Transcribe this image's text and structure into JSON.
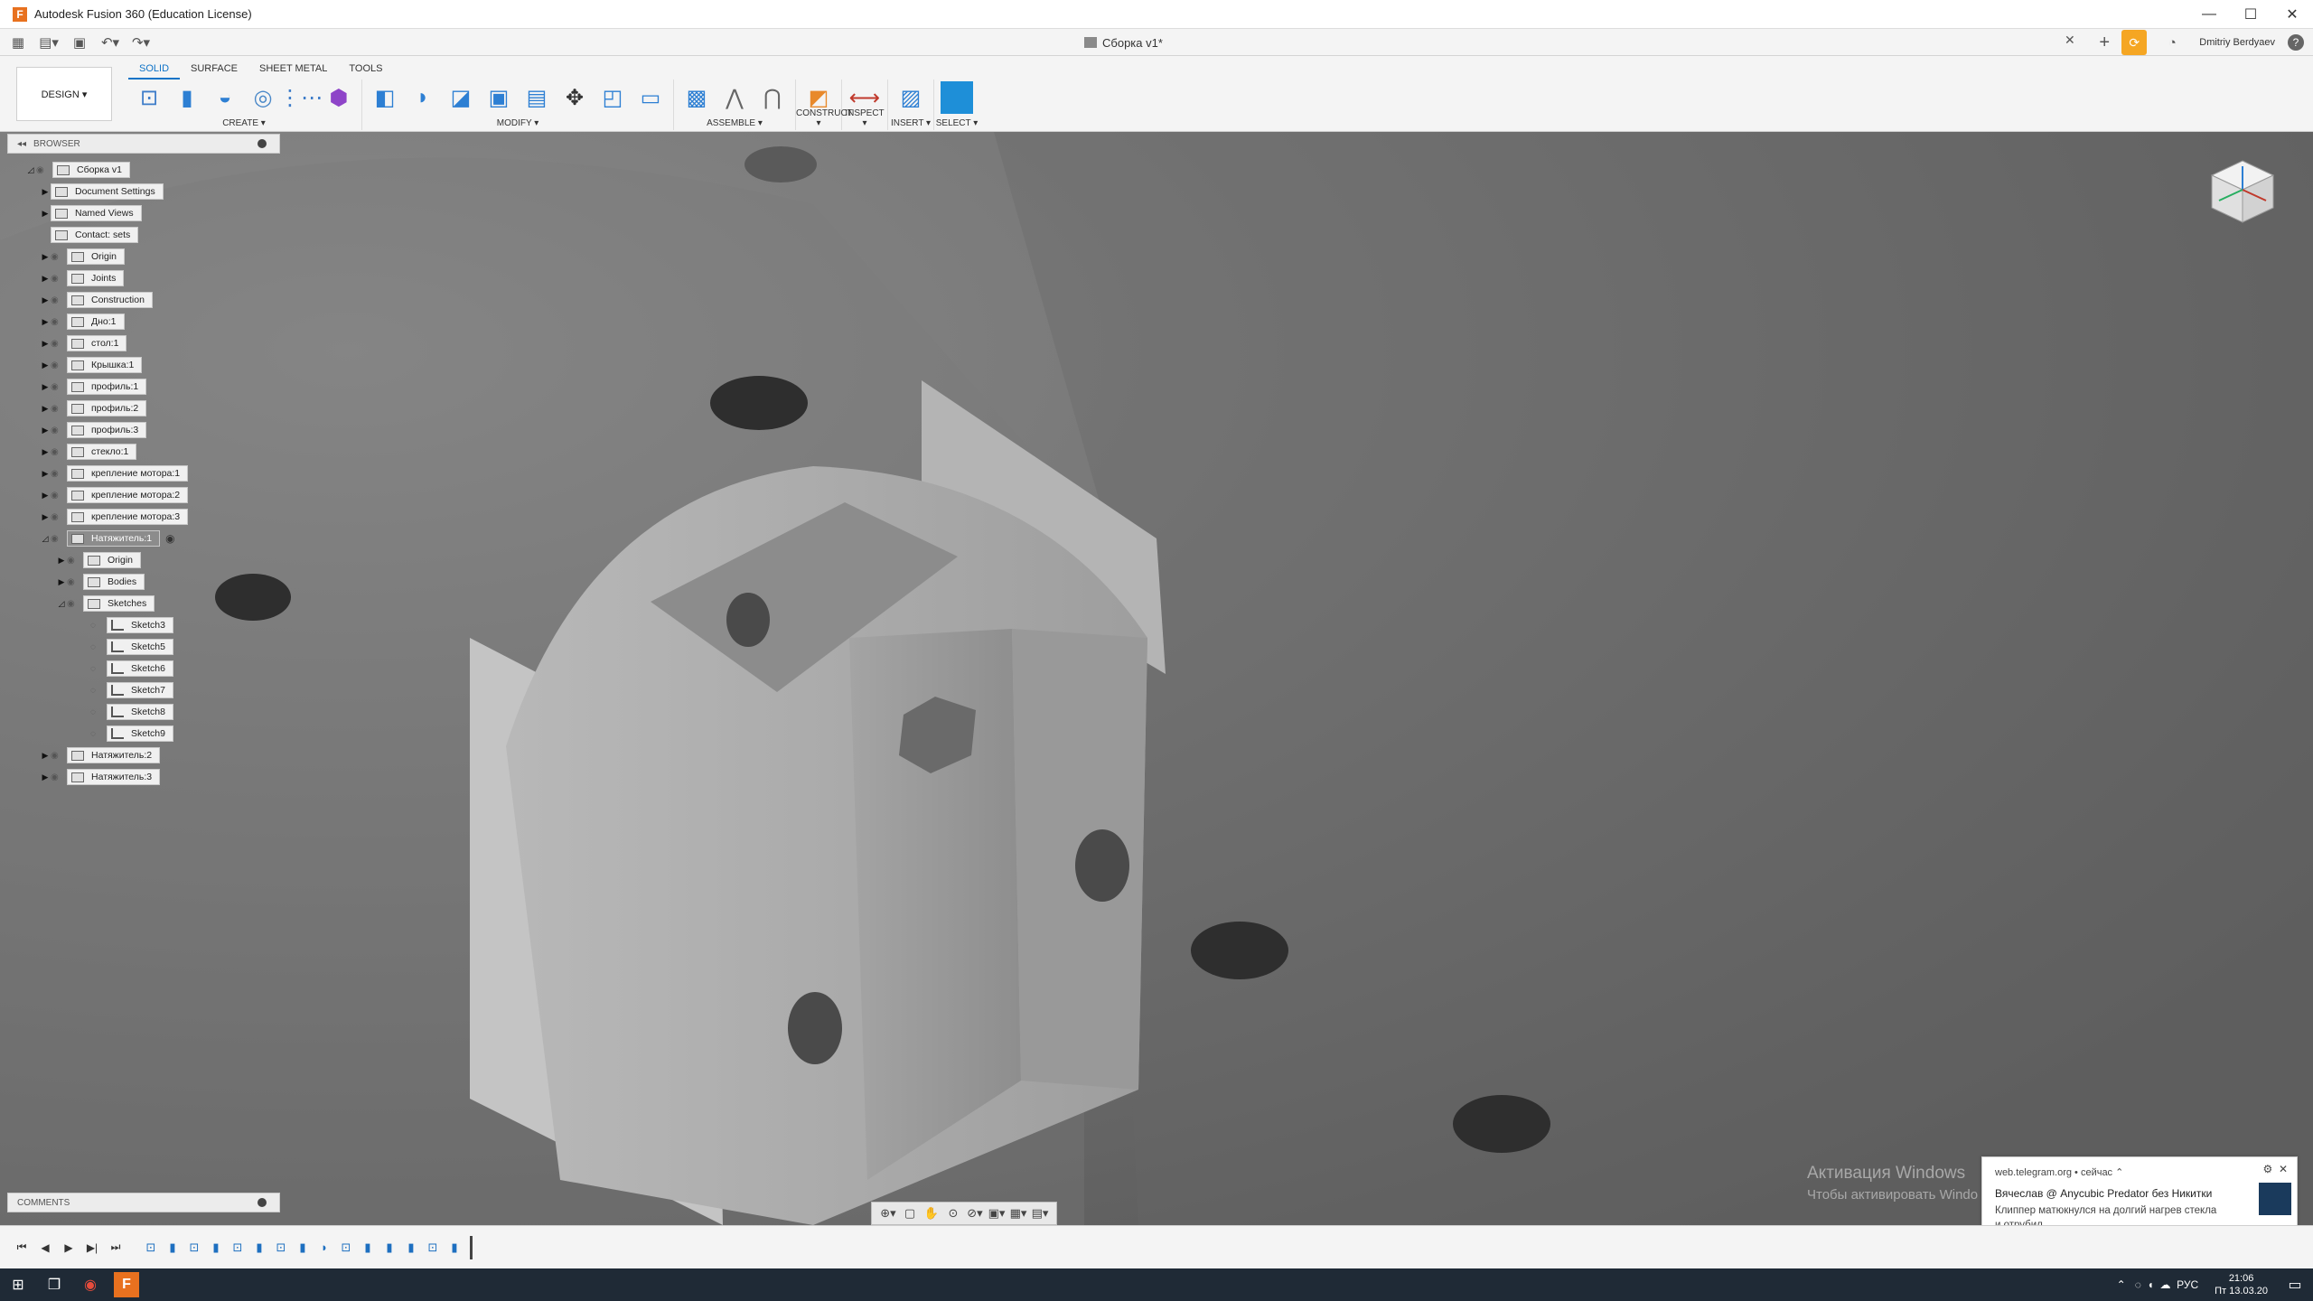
{
  "window": {
    "title": "Autodesk Fusion 360 (Education License)"
  },
  "doc": {
    "tab_title": "Сборка v1*",
    "user": "Dmitriy Berdyaev"
  },
  "workspace": {
    "label": "DESIGN ▾"
  },
  "tabs": [
    "SOLID",
    "SURFACE",
    "SHEET METAL",
    "TOOLS"
  ],
  "groups": [
    {
      "label": "CREATE ▾",
      "icons": [
        "sketch-icon",
        "extrude-icon",
        "revolve-icon",
        "hole-icon",
        "pattern-icon",
        "form-icon"
      ]
    },
    {
      "label": "MODIFY ▾",
      "icons": [
        "press-pull-icon",
        "fillet-icon",
        "chamfer-icon",
        "shell-icon",
        "combine-icon",
        "move-icon",
        "scale-icon",
        "align-icon"
      ]
    },
    {
      "label": "ASSEMBLE ▾",
      "icons": [
        "new-component-icon",
        "joint-icon",
        "as-built-joint-icon"
      ]
    },
    {
      "label": "CONSTRUCT ▾",
      "icons": [
        "offset-plane-icon"
      ]
    },
    {
      "label": "INSPECT ▾",
      "icons": [
        "measure-icon"
      ]
    },
    {
      "label": "INSERT ▾",
      "icons": [
        "insert-image-icon"
      ]
    },
    {
      "label": "SELECT ▾",
      "icons": [
        "select-icon"
      ]
    }
  ],
  "browser": {
    "title": "BROWSER",
    "items": [
      {
        "label": "Сборка v1",
        "level": 0,
        "expanded": true
      },
      {
        "label": "Document Settings",
        "level": 1
      },
      {
        "label": "Named Views",
        "level": 1
      },
      {
        "label": "Contact: sets",
        "level": 1
      },
      {
        "label": "Origin",
        "level": 1
      },
      {
        "label": "Joints",
        "level": 1
      },
      {
        "label": "Construction",
        "level": 1
      },
      {
        "label": "Дно:1",
        "level": 1
      },
      {
        "label": "стол:1",
        "level": 1
      },
      {
        "label": "Крышка:1",
        "level": 1
      },
      {
        "label": "профиль:1",
        "level": 1
      },
      {
        "label": "профиль:2",
        "level": 1
      },
      {
        "label": "профиль:3",
        "level": 1
      },
      {
        "label": "стекло:1",
        "level": 1
      },
      {
        "label": "крепление мотора:1",
        "level": 1
      },
      {
        "label": "крепление мотора:2",
        "level": 1
      },
      {
        "label": "крепление мотора:3",
        "level": 1
      },
      {
        "label": "Натяжитель:1",
        "level": 1,
        "expanded": true,
        "selected": true
      },
      {
        "label": "Origin",
        "level": 2
      },
      {
        "label": "Bodies",
        "level": 2
      },
      {
        "label": "Sketches",
        "level": 2,
        "expanded": true
      },
      {
        "label": "Sketch3",
        "level": 3,
        "sketch": true
      },
      {
        "label": "Sketch5",
        "level": 3,
        "sketch": true
      },
      {
        "label": "Sketch6",
        "level": 3,
        "sketch": true
      },
      {
        "label": "Sketch7",
        "level": 3,
        "sketch": true
      },
      {
        "label": "Sketch8",
        "level": 3,
        "sketch": true
      },
      {
        "label": "Sketch9",
        "level": 3,
        "sketch": true
      },
      {
        "label": "Натяжитель:2",
        "level": 1
      },
      {
        "label": "Натяжитель:3",
        "level": 1
      }
    ]
  },
  "comments": {
    "title": "COMMENTS"
  },
  "activation": {
    "line1": "Активация Windows",
    "line2": "Чтобы активировать Windo"
  },
  "notification": {
    "source": "web.telegram.org • сейчас ⌃",
    "title": "Вячеслав @ Anycubic Predator без Никитки",
    "body": "Клиппер матюкнулся на долгий нагрев стекла и отрубил"
  },
  "taskbar": {
    "lang": "РУС",
    "time": "21:06",
    "date": "Пт 13.03.20"
  }
}
